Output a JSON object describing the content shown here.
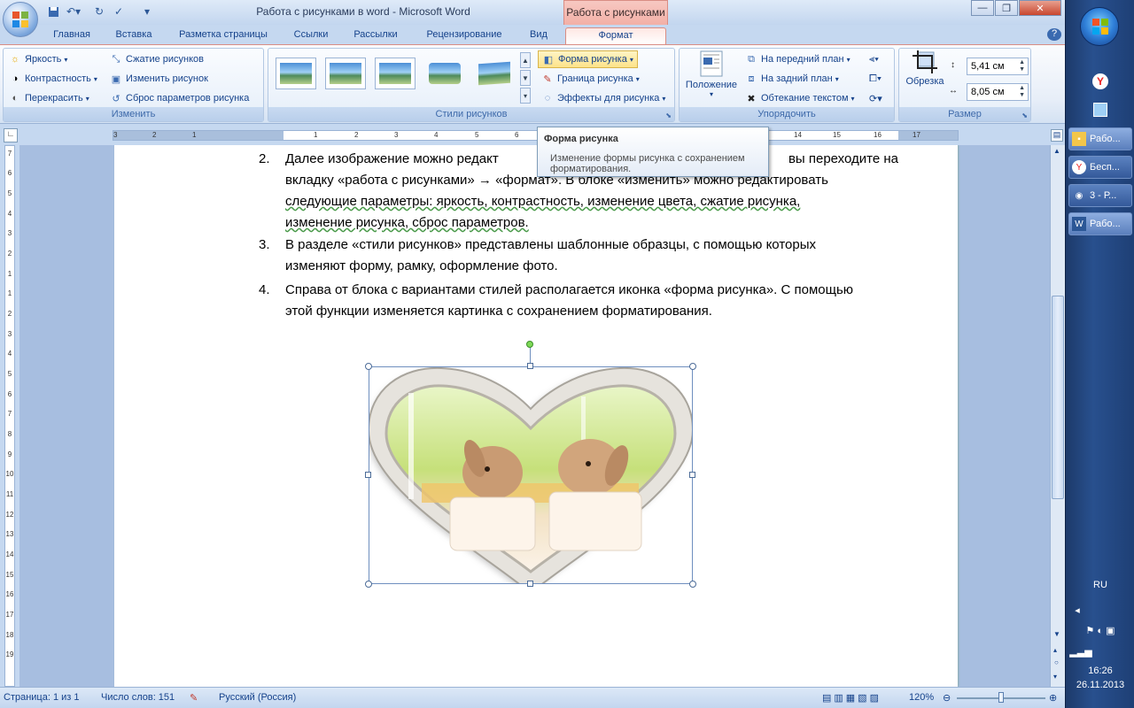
{
  "window": {
    "title": "Работа с рисунками в word - Microsoft Word",
    "context_title": "Работа с рисунками"
  },
  "tabs": [
    "Главная",
    "Вставка",
    "Разметка страницы",
    "Ссылки",
    "Рассылки",
    "Рецензирование",
    "Вид",
    "Формат"
  ],
  "ribbon": {
    "adjust": {
      "label": "Изменить",
      "brightness": "Яркость",
      "contrast": "Контрастность",
      "recolor": "Перекрасить",
      "compress": "Сжатие рисунков",
      "change": "Изменить рисунок",
      "reset": "Сброс параметров рисунка"
    },
    "styles": {
      "label": "Стили рисунков",
      "shape": "Форма рисунка",
      "border": "Граница рисунка",
      "effects": "Эффекты для рисунка"
    },
    "arrange": {
      "label": "Упорядочить",
      "position": "Положение",
      "front": "На передний план",
      "back": "На задний план",
      "wrap": "Обтекание текстом"
    },
    "size": {
      "label": "Размер",
      "crop": "Обрезка",
      "height": "5,41 см",
      "width": "8,05 см"
    }
  },
  "tooltip": {
    "title": "Форма рисунка",
    "body": "Изменение формы рисунка с сохранением форматирования."
  },
  "document": {
    "items": [
      {
        "num": "2.",
        "lines": [
          "Далее изображение можно редакт",
          "вы переходите на",
          "вкладку «работа с рисунками» → «формат». В блоке «изменить» можно редактировать",
          "следующие параметры: яркость, контрастность, изменение цвета, сжатие рисунка,",
          "изменение рисунка, сброс параметров."
        ]
      },
      {
        "num": "3.",
        "lines": [
          "В разделе «стили рисунков» представлены шаблонные образцы, с помощью которых",
          "изменяют форму, рамку, оформление фото."
        ]
      },
      {
        "num": "4.",
        "lines": [
          "Справа от блока с вариантами стилей располагается иконка «форма рисунка». С помощью",
          "этой функции изменяется картинка с сохранением форматирования."
        ]
      }
    ]
  },
  "ruler": {
    "h_numbers": [
      "3",
      "2",
      "1",
      "1",
      "2",
      "3",
      "4",
      "5",
      "6",
      "7",
      "14",
      "15",
      "16",
      "17"
    ],
    "v_numbers": [
      "7",
      "6",
      "5",
      "4",
      "3",
      "2",
      "1",
      "1",
      "2",
      "3",
      "4",
      "5",
      "6",
      "7",
      "8",
      "9",
      "10",
      "11",
      "12",
      "13",
      "14",
      "15",
      "16",
      "17",
      "18",
      "19"
    ]
  },
  "status": {
    "page": "Страница: 1 из 1",
    "words": "Число слов: 151",
    "language": "Русский (Россия)",
    "zoom": "120%"
  },
  "taskbar": {
    "windows": [
      "Рабо...",
      "Бесп...",
      "3 - Р...",
      "Рабо..."
    ],
    "lang": "RU",
    "time": "16:26",
    "date": "26.11.2013"
  },
  "colors": {
    "ribbon_bg": "#dfe9f5",
    "context_tab": "#f2b0a7",
    "doc_bg": "#a7bee0",
    "taskbar": "#28508e"
  }
}
